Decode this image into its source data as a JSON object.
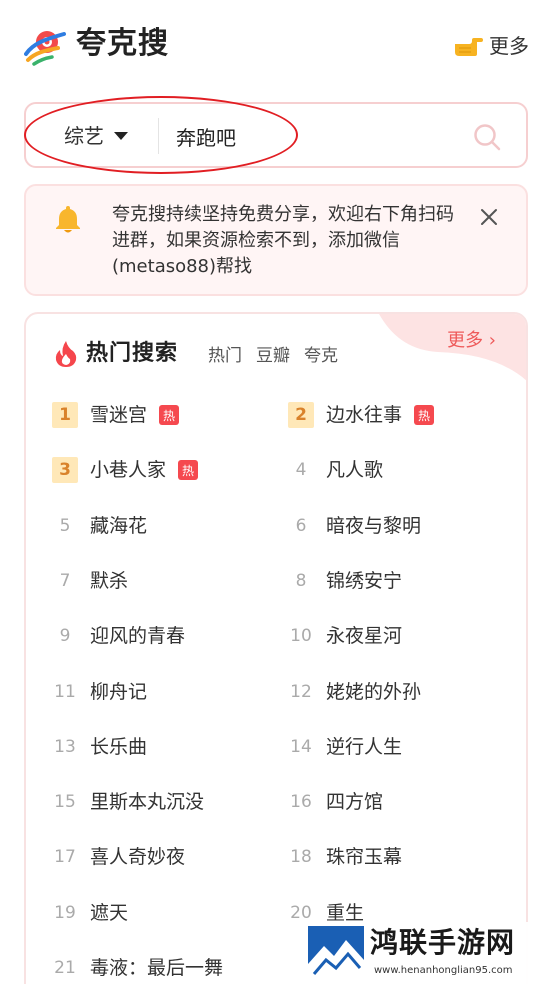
{
  "header": {
    "title": "夸克搜",
    "more_label": "更多",
    "logo_icon": "quark-planet-logo",
    "more_icon": "pointing-hand-icon"
  },
  "search": {
    "category": "综艺",
    "query": "奔跑吧",
    "icon": "search-icon"
  },
  "notice": {
    "text": "夸克搜持续坚持免费分享，欢迎右下角扫码进群，如果资源检索不到，添加微信(metaso88)帮找",
    "icon": "bell-icon"
  },
  "hot": {
    "title": "热门搜索",
    "more_label": "更多 ›",
    "tabs": [
      "热门",
      "豆瓣",
      "夸克"
    ],
    "badge_label": "热",
    "items": [
      {
        "rank": "1",
        "title": "雪迷宫",
        "hot": true
      },
      {
        "rank": "2",
        "title": "边水往事",
        "hot": true
      },
      {
        "rank": "3",
        "title": "小巷人家",
        "hot": true
      },
      {
        "rank": "4",
        "title": "凡人歌",
        "hot": false
      },
      {
        "rank": "5",
        "title": "藏海花",
        "hot": false
      },
      {
        "rank": "6",
        "title": "暗夜与黎明",
        "hot": false
      },
      {
        "rank": "7",
        "title": "默杀",
        "hot": false
      },
      {
        "rank": "8",
        "title": "锦绣安宁",
        "hot": false
      },
      {
        "rank": "9",
        "title": "迎风的青春",
        "hot": false
      },
      {
        "rank": "10",
        "title": "永夜星河",
        "hot": false
      },
      {
        "rank": "11",
        "title": "柳舟记",
        "hot": false
      },
      {
        "rank": "12",
        "title": "姥姥的外孙",
        "hot": false
      },
      {
        "rank": "13",
        "title": "长乐曲",
        "hot": false
      },
      {
        "rank": "14",
        "title": "逆行人生",
        "hot": false
      },
      {
        "rank": "15",
        "title": "里斯本丸沉没",
        "hot": false
      },
      {
        "rank": "16",
        "title": "四方馆",
        "hot": false
      },
      {
        "rank": "17",
        "title": "喜人奇妙夜",
        "hot": false
      },
      {
        "rank": "18",
        "title": "珠帘玉幕",
        "hot": false
      },
      {
        "rank": "19",
        "title": "遮天",
        "hot": false
      },
      {
        "rank": "20",
        "title": "重生",
        "hot": false
      },
      {
        "rank": "21",
        "title": "毒液：最后一舞",
        "hot": false
      }
    ]
  },
  "watermark": {
    "text": "鸿联手游网",
    "url": "www.henanhonglian95.com"
  },
  "colors": {
    "accent": "#ee5a5a",
    "border": "#f6cfd0",
    "notice_bg": "#fff5f5",
    "rank_top_bg": "#ffe8b8",
    "rank_top_fg": "#d9822b",
    "badge": "#f5494f",
    "annotation": "#e11e23"
  }
}
